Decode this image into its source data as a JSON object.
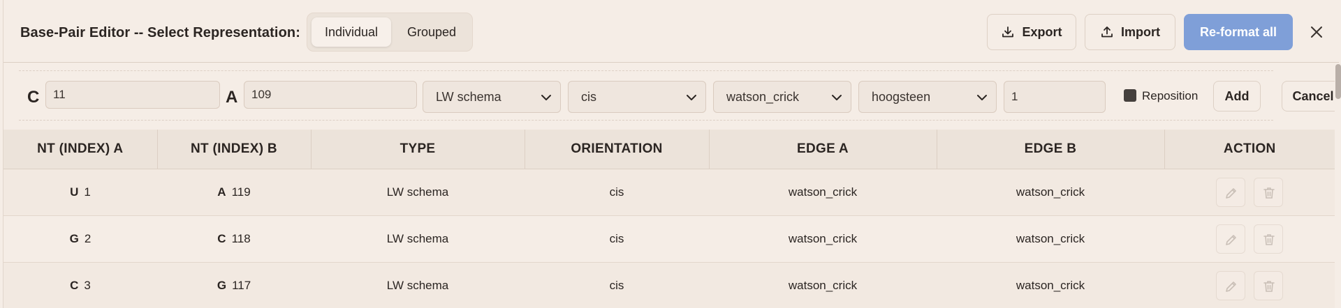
{
  "header": {
    "title": "Base-Pair Editor -- Select Representation:",
    "representation": {
      "active": "Individual",
      "inactive": "Grouped"
    },
    "export_label": "Export",
    "import_label": "Import",
    "reformat_label": "Re-format all",
    "colors": {
      "primary": "#7f9fd8",
      "background": "#f5ede6"
    }
  },
  "form": {
    "label_a": "C",
    "value_a": "11",
    "label_b": "A",
    "value_b": "109",
    "type": "LW schema",
    "orientation": "cis",
    "edge_a": "watson_crick",
    "edge_b": "hoogsteen",
    "count": "1",
    "reposition_label": "Reposition",
    "add_label": "Add",
    "cancel_label": "Cancel"
  },
  "table": {
    "headers": [
      "NT (INDEX) A",
      "NT (INDEX) B",
      "TYPE",
      "ORIENTATION",
      "EDGE A",
      "EDGE B",
      "ACTION"
    ],
    "rows": [
      {
        "nt_a": "U",
        "idx_a": "1",
        "nt_b": "A",
        "idx_b": "119",
        "type": "LW schema",
        "orientation": "cis",
        "edge_a": "watson_crick",
        "edge_b": "watson_crick"
      },
      {
        "nt_a": "G",
        "idx_a": "2",
        "nt_b": "C",
        "idx_b": "118",
        "type": "LW schema",
        "orientation": "cis",
        "edge_a": "watson_crick",
        "edge_b": "watson_crick"
      },
      {
        "nt_a": "C",
        "idx_a": "3",
        "nt_b": "G",
        "idx_b": "117",
        "type": "LW schema",
        "orientation": "cis",
        "edge_a": "watson_crick",
        "edge_b": "watson_crick"
      }
    ],
    "action_icons": [
      "pencil-icon",
      "trash-icon"
    ]
  }
}
